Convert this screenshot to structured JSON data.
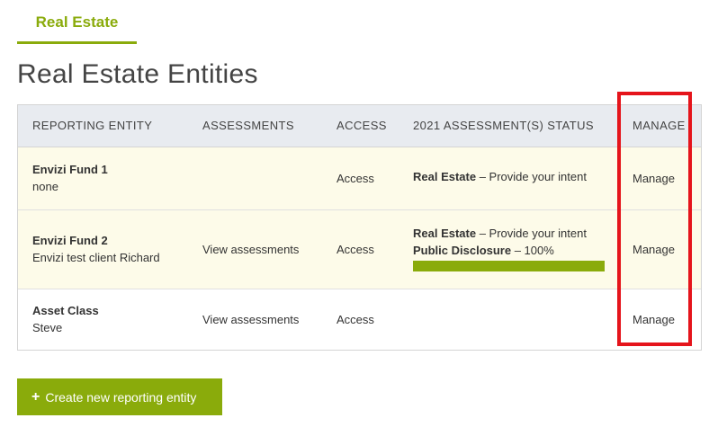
{
  "tab": {
    "label": "Real Estate"
  },
  "page": {
    "title": "Real Estate Entities"
  },
  "table": {
    "headers": {
      "entity": "REPORTING ENTITY",
      "assessments": "ASSESSMENTS",
      "access": "ACCESS",
      "status": "2021 ASSESSMENT(S) STATUS",
      "manage": "MANAGE"
    },
    "rows": [
      {
        "name": "Envizi Fund 1",
        "sub": "none",
        "assessments": "",
        "access": "Access",
        "status": [
          {
            "bold": "Real Estate",
            "rest": " – Provide your intent"
          }
        ],
        "manage": "Manage",
        "highlighted": true
      },
      {
        "name": "Envizi Fund 2",
        "sub": "Envizi test client Richard",
        "assessments": "View assessments",
        "access": "Access",
        "status": [
          {
            "bold": "Real Estate",
            "rest": " – Provide your intent"
          },
          {
            "bold": "Public Disclosure",
            "rest": " – 100%"
          }
        ],
        "progress": 1.0,
        "manage": "Manage",
        "highlighted": true
      },
      {
        "name": "Asset Class",
        "sub": "Steve",
        "assessments": "View assessments",
        "access": "Access",
        "status": [],
        "manage": "Manage",
        "highlighted": false
      }
    ]
  },
  "actions": {
    "create_label": "Create new reporting entity",
    "create_icon": "plus-icon"
  },
  "colors": {
    "accent": "#8aab0b",
    "highlight_row": "#fdfbe9",
    "header_bg": "#e8ebf0",
    "annotation": "#e5141b"
  }
}
